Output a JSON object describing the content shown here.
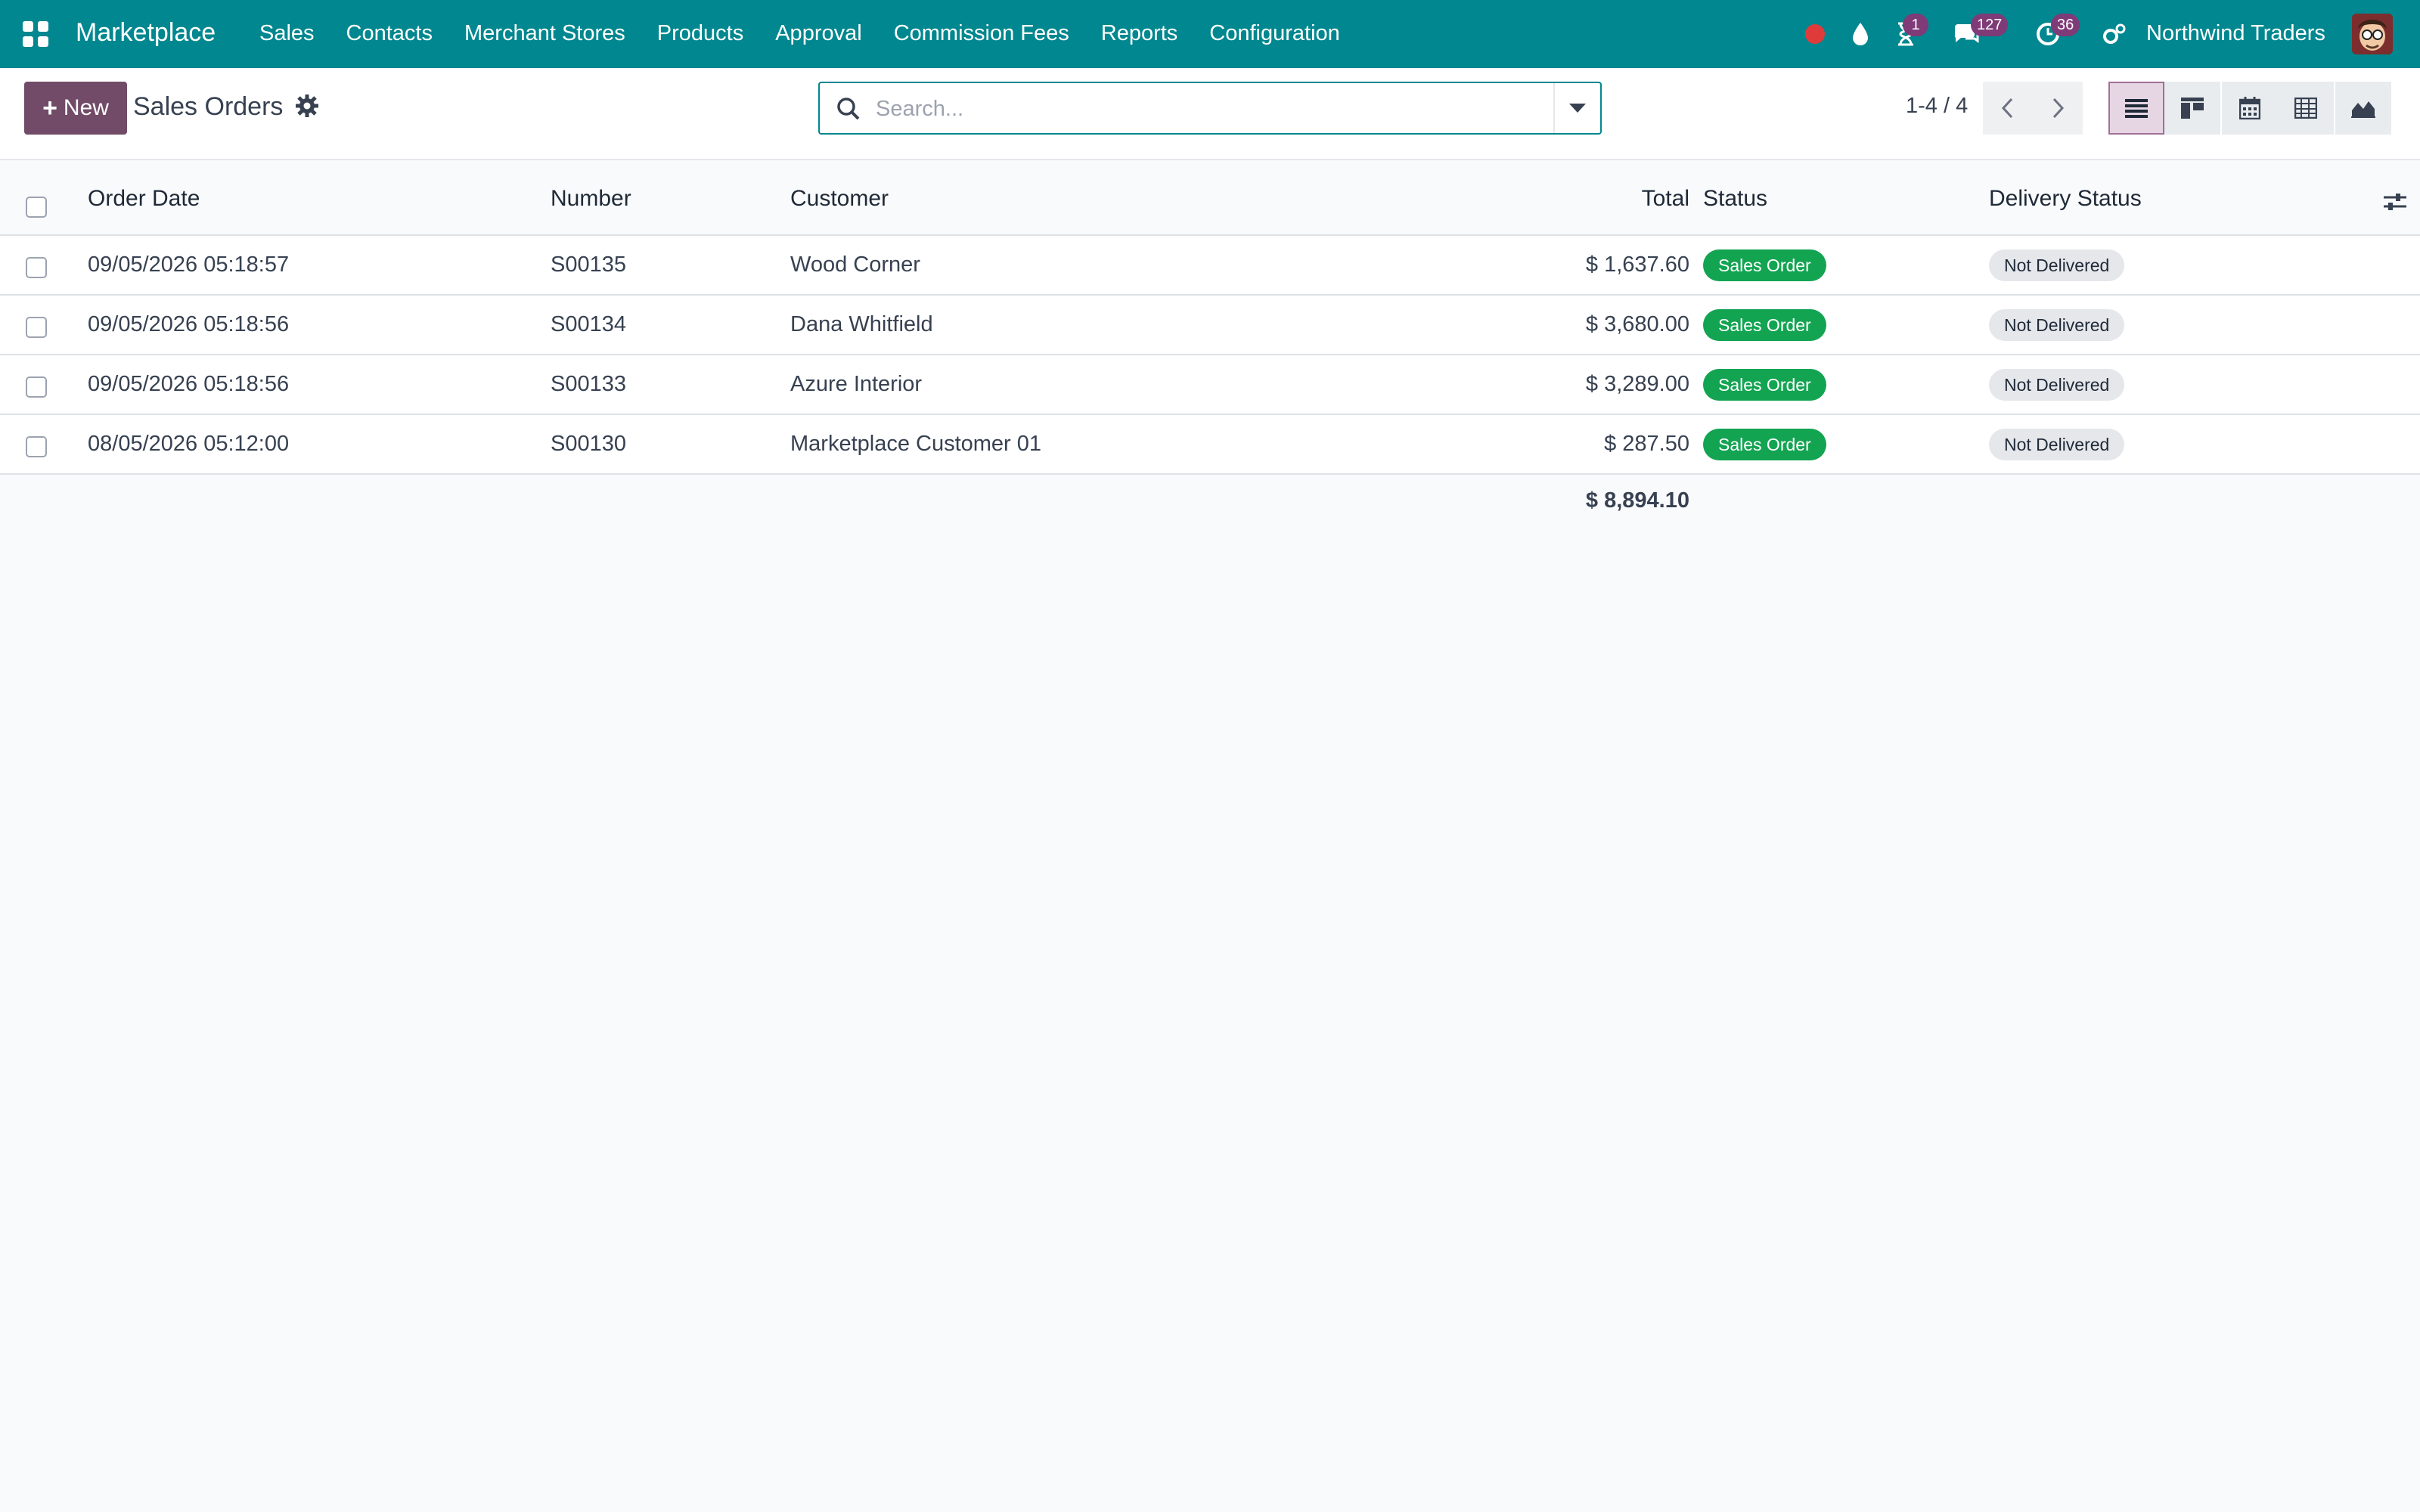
{
  "navbar": {
    "brand": "Marketplace",
    "menu": [
      "Sales",
      "Contacts",
      "Merchant Stores",
      "Products",
      "Approval",
      "Commission Fees",
      "Reports",
      "Configuration"
    ],
    "activity_badge": "1",
    "messages_badge": "127",
    "clock_badge": "36",
    "company": "Northwind Traders"
  },
  "control": {
    "new_label": "New",
    "title": "Sales Orders",
    "search_placeholder": "Search...",
    "pager": "1-4 / 4"
  },
  "table": {
    "headers": {
      "order_date": "Order Date",
      "number": "Number",
      "customer": "Customer",
      "total": "Total",
      "status": "Status",
      "delivery_status": "Delivery Status"
    },
    "rows": [
      {
        "order_date": "09/05/2026 05:18:57",
        "number": "S00135",
        "customer": "Wood Corner",
        "total": "$ 1,637.60",
        "status": "Sales Order",
        "delivery_status": "Not Delivered"
      },
      {
        "order_date": "09/05/2026 05:18:56",
        "number": "S00134",
        "customer": "Dana Whitfield",
        "total": "$ 3,680.00",
        "status": "Sales Order",
        "delivery_status": "Not Delivered"
      },
      {
        "order_date": "09/05/2026 05:18:56",
        "number": "S00133",
        "customer": "Azure Interior",
        "total": "$ 3,289.00",
        "status": "Sales Order",
        "delivery_status": "Not Delivered"
      },
      {
        "order_date": "08/05/2026 05:12:00",
        "number": "S00130",
        "customer": "Marketplace Customer 01",
        "total": "$ 287.50",
        "status": "Sales Order",
        "delivery_status": "Not Delivered"
      }
    ],
    "grand_total": "$ 8,894.10"
  },
  "colors": {
    "navbar": "#01878f",
    "primary_button": "#714b67",
    "status_tag": "#13a452",
    "delivery_tag": "#e5e7eb"
  }
}
